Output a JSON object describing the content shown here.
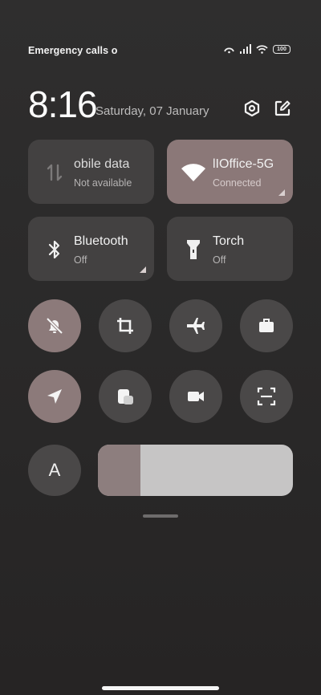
{
  "status_bar": {
    "carrier_text": "Emergency calls o",
    "battery_level": "100",
    "icons": [
      "hotspot-icon",
      "signal-icon",
      "wifi-icon",
      "battery-icon"
    ]
  },
  "header": {
    "time": "8:16",
    "date": "Saturday, 07 January"
  },
  "tiles": [
    {
      "title": "obile data",
      "subtitle": "Not available",
      "icon": "mobile-data-icon",
      "active": false
    },
    {
      "title": "lIOffice-5G",
      "subtitle": "Connected",
      "icon": "wifi-icon",
      "active": true
    },
    {
      "title": "Bluetooth",
      "subtitle": "Off",
      "icon": "bluetooth-icon",
      "active": false
    },
    {
      "title": "Torch",
      "subtitle": "Off",
      "icon": "torch-icon",
      "active": false
    }
  ],
  "toggles_row1": [
    {
      "icon": "mute-bell-icon",
      "active": true
    },
    {
      "icon": "screenshot-crop-icon",
      "active": false
    },
    {
      "icon": "airplane-icon",
      "active": false
    },
    {
      "icon": "work-briefcase-icon",
      "active": false
    }
  ],
  "toggles_row2": [
    {
      "icon": "location-arrow-icon",
      "active": true
    },
    {
      "icon": "floating-window-icon",
      "active": false
    },
    {
      "icon": "screen-record-icon",
      "active": false
    },
    {
      "icon": "scan-icon",
      "active": false
    }
  ],
  "brightness": {
    "auto_label": "A",
    "level_fraction": 0.22
  },
  "colors": {
    "active_tile": "#8b7878",
    "inactive_tile": "#434141",
    "slider_track": "#c6c5c5",
    "slider_fill": "#8d7e7e"
  }
}
